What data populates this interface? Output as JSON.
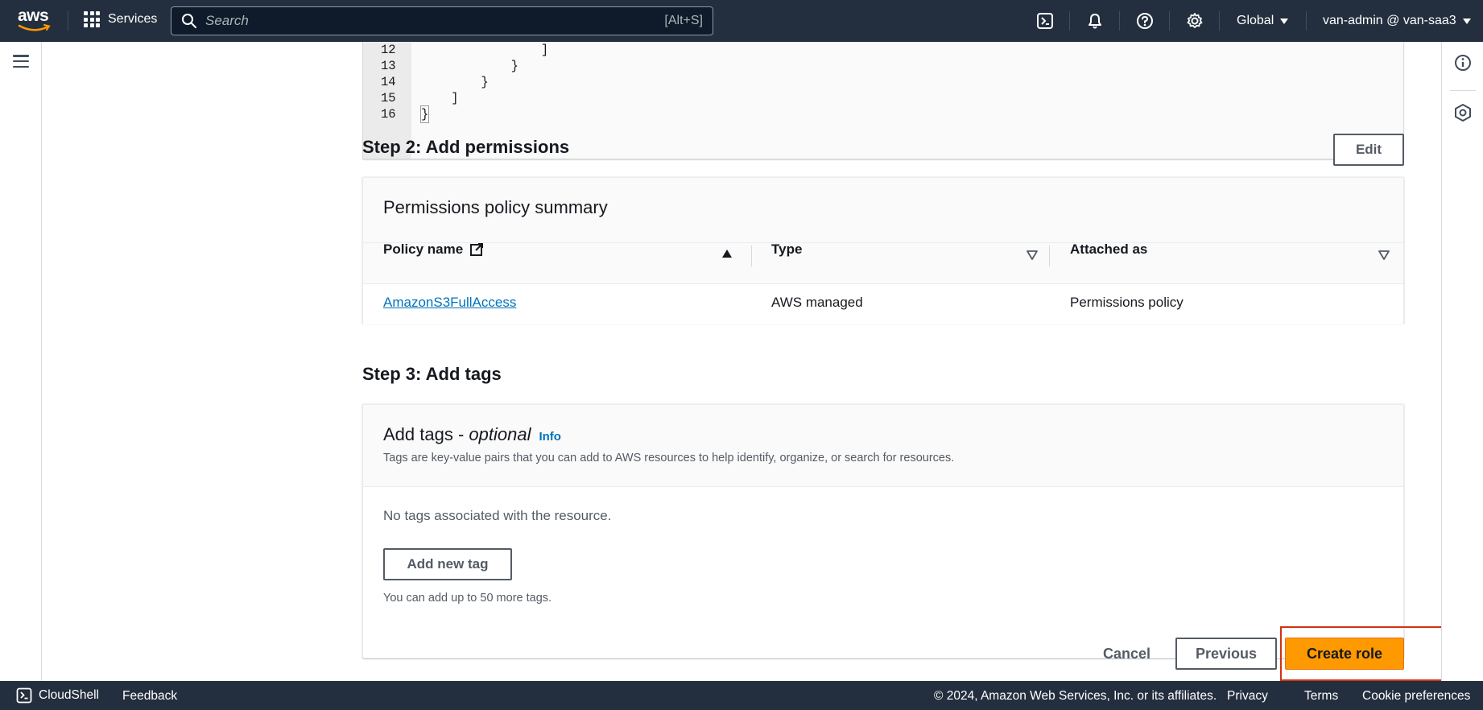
{
  "topnav": {
    "logo_text": "aws",
    "services_label": "Services",
    "search_placeholder": "Search",
    "search_shortcut": "[Alt+S]",
    "region_label": "Global",
    "account_label": "van-admin @ van-saa3"
  },
  "code_editor": {
    "lines": [
      {
        "num": "12",
        "code": "                ]"
      },
      {
        "num": "13",
        "code": "            }"
      },
      {
        "num": "14",
        "code": "        }"
      },
      {
        "num": "15",
        "code": "    ]"
      },
      {
        "num": "16",
        "code": "}"
      }
    ]
  },
  "step2": {
    "title": "Step 2: Add permissions",
    "edit_label": "Edit",
    "panel_title": "Permissions policy summary",
    "columns": [
      "Policy name",
      "Type",
      "Attached as"
    ],
    "rows": [
      {
        "policy_name": "AmazonS3FullAccess",
        "type": "AWS managed",
        "attached_as": "Permissions policy"
      }
    ]
  },
  "step3": {
    "title": "Step 3: Add tags",
    "panel_title_prefix": "Add tags - ",
    "panel_title_optional": "optional",
    "info_label": "Info",
    "description": "Tags are key-value pairs that you can add to AWS resources to help identify, organize, or search for resources.",
    "empty_text": "No tags associated with the resource.",
    "add_tag_label": "Add new tag",
    "limit_text": "You can add up to 50 more tags."
  },
  "actions": {
    "cancel_label": "Cancel",
    "previous_label": "Previous",
    "create_label": "Create role"
  },
  "footer": {
    "cloudshell_label": "CloudShell",
    "feedback_label": "Feedback",
    "copyright": "© 2024, Amazon Web Services, Inc. or its affiliates.",
    "privacy_label": "Privacy",
    "terms_label": "Terms",
    "cookie_label": "Cookie preferences"
  },
  "colors": {
    "nav_bg": "#232f3e",
    "primary_button": "#ff9900",
    "link": "#0073bb",
    "highlight_border": "#d13212"
  }
}
